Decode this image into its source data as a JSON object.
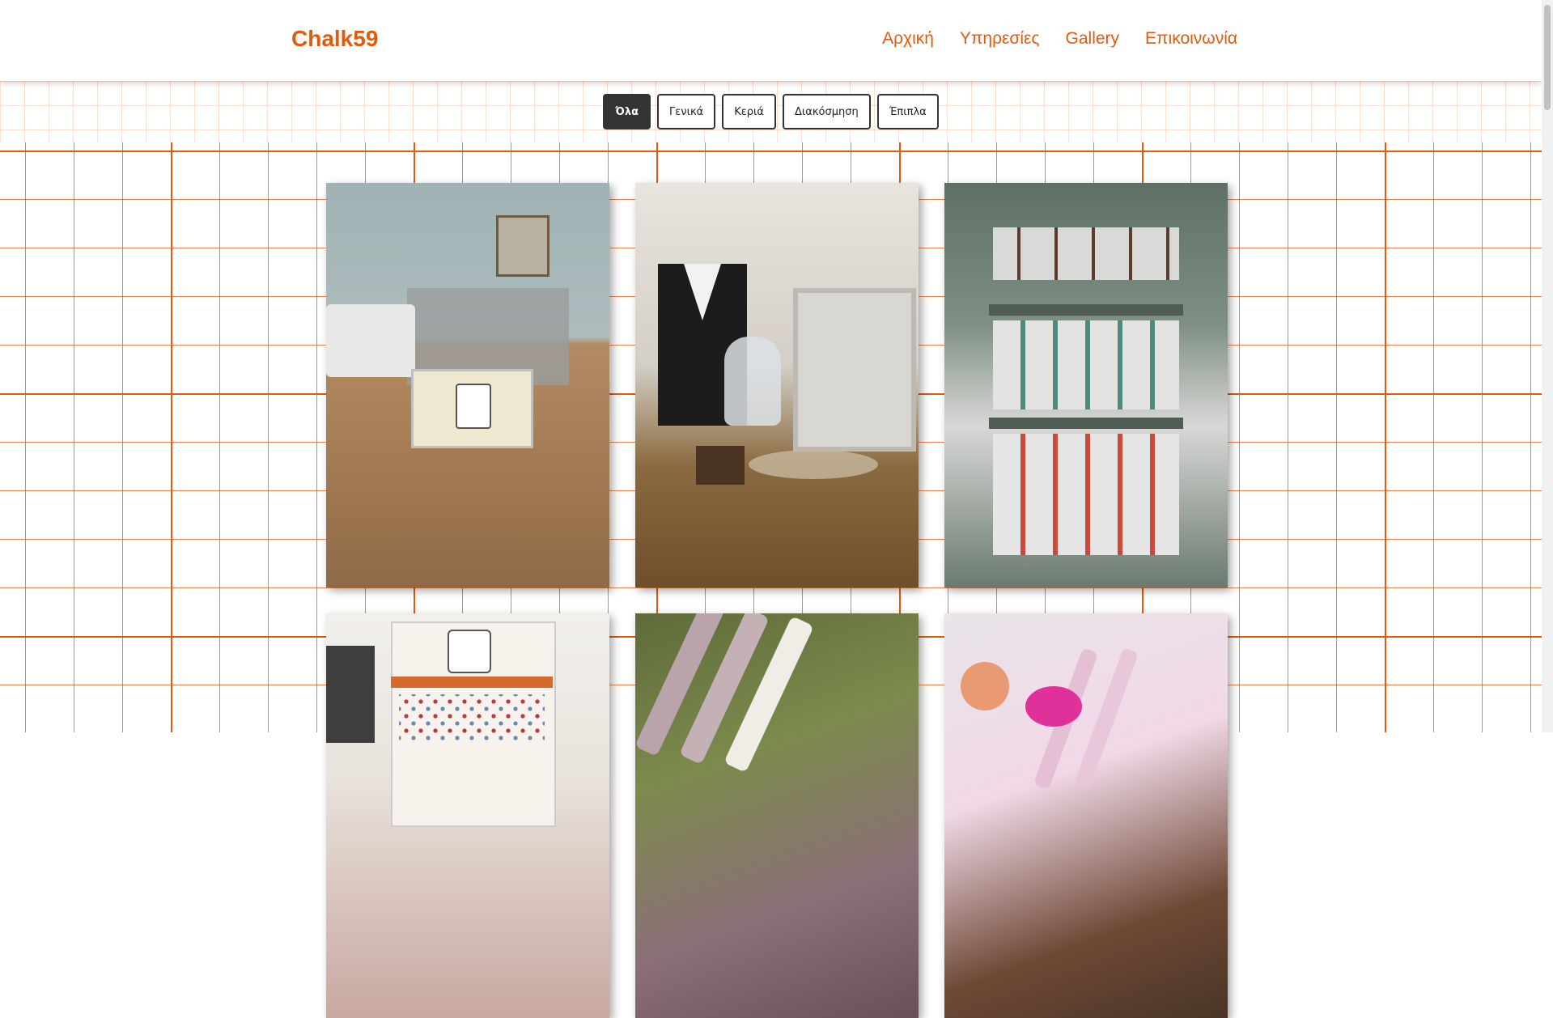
{
  "site": {
    "logo": "Chalk59"
  },
  "nav": {
    "items": [
      "Αρχική",
      "Υπηρεσίες",
      "Gallery",
      "Επικοινωνία"
    ]
  },
  "filters": {
    "items": [
      "Όλα",
      "Γενικά",
      "Κεριά",
      "Διακόσμηση",
      "Έπιπλα"
    ],
    "active": "Όλα"
  },
  "gallery": {
    "photos": [
      {
        "subject": "Chalk 59 business card holder on wooden desk"
      },
      {
        "subject": "Wedding decoration set with tuxedo box, decanter and glasses"
      },
      {
        "subject": "Shelf with chalk paint jars"
      },
      {
        "subject": "Chalk 59 color chart board"
      },
      {
        "subject": "Decorated candles on green fabric"
      },
      {
        "subject": "Pink baptism candles with doll decoration"
      }
    ]
  },
  "colors": {
    "accent": "#e25a0c",
    "button_active": "#333333"
  }
}
